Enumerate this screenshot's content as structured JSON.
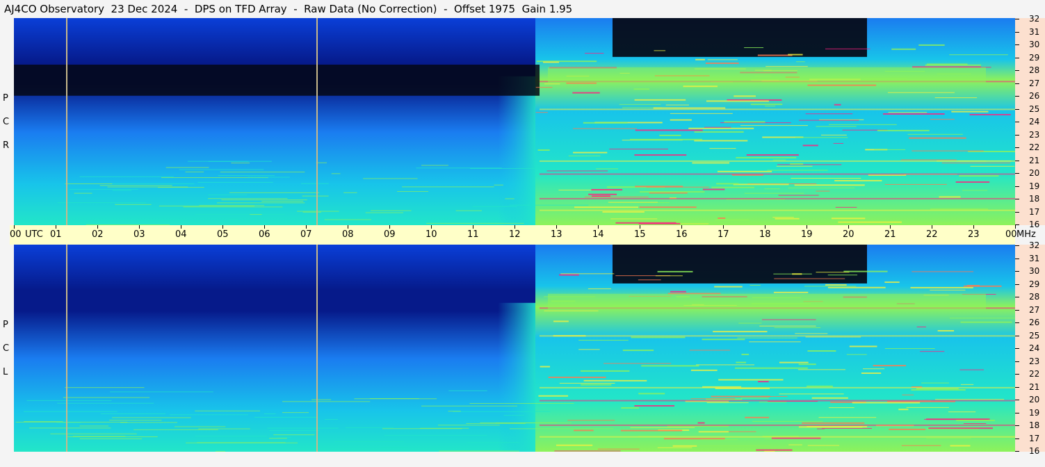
{
  "title": "AJ4CO Observatory  23 Dec 2024  -  DPS on TFD Array  -  Raw Data (No Correction)  -  Offset 1975  Gain 1.95",
  "panels": [
    {
      "id": "rcp",
      "label_letters": [
        "R",
        "C",
        "P"
      ]
    },
    {
      "id": "lcp",
      "label_letters": [
        "L",
        "C",
        "P"
      ]
    }
  ],
  "time_axis": {
    "utc_label": "UTC",
    "ticks": [
      "00",
      "01",
      "02",
      "03",
      "04",
      "05",
      "06",
      "07",
      "08",
      "09",
      "10",
      "11",
      "12",
      "13",
      "14",
      "15",
      "16",
      "17",
      "18",
      "19",
      "20",
      "21",
      "22",
      "23",
      "00"
    ],
    "end_unit": "MHz"
  },
  "freq_axis": {
    "ticks": [
      "32",
      "31",
      "30",
      "29",
      "28",
      "27",
      "26",
      "25",
      "24",
      "23",
      "22",
      "21",
      "20",
      "19",
      "18",
      "17",
      "16"
    ]
  },
  "colors": {
    "background": "#f4f4f4",
    "time_axis_bg": "#ffffc8",
    "freq_axis_bg": "#fce0cf",
    "colormap": [
      "#050814",
      "#061a8a",
      "#0a3fd8",
      "#1a7cf0",
      "#18c4ea",
      "#22e6c8",
      "#8ef25a",
      "#f0f040",
      "#ff7a50",
      "#ff2080"
    ]
  },
  "chart_data": {
    "type": "heatmap",
    "title": "AJ4CO Observatory  23 Dec 2024  -  DPS on TFD Array  -  Raw Data (No Correction)  -  Offset 1975  Gain 1.95",
    "x_label": "UTC",
    "y_label": "MHz",
    "x_range_hours": [
      0,
      24
    ],
    "y_range_mhz": [
      16,
      32
    ],
    "series": [
      {
        "name": "RCP",
        "region_levels": [
          {
            "hours": [
              0,
              12.5
            ],
            "level": "low"
          },
          {
            "hours": [
              12.5,
              24
            ],
            "level": "high"
          }
        ]
      },
      {
        "name": "LCP",
        "region_levels": [
          {
            "hours": [
              0,
              12.5
            ],
            "level": "low"
          },
          {
            "hours": [
              12.5,
              24
            ],
            "level": "high"
          }
        ]
      }
    ],
    "vertical_markers_hours": [
      1.25,
      7.25
    ],
    "dark_band_hours": [
      14.35,
      20.45
    ],
    "dark_band_mhz": [
      29,
      32
    ]
  }
}
